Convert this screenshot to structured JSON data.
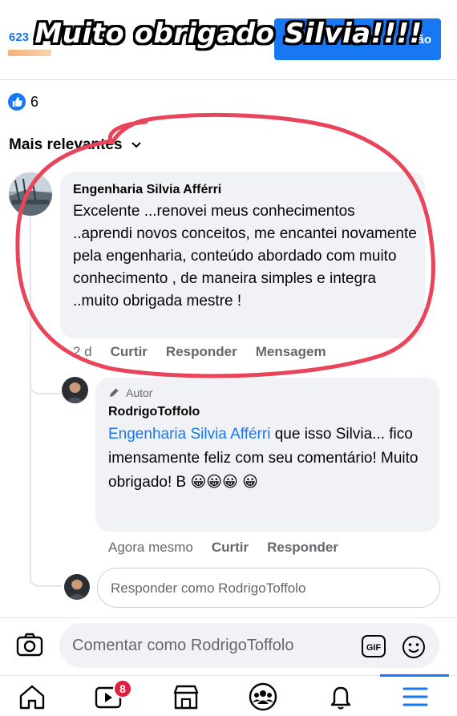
{
  "header": {
    "count_label": "623",
    "button_label": "ão",
    "overlay_title": "Muito obrigado Silvia!!!!"
  },
  "reactions": {
    "count": "6"
  },
  "sort": {
    "label": "Mais relevantes"
  },
  "comment": {
    "author": "Engenharia Silvia Afférri",
    "text": "Excelente ...renovei meus conhecimentos ..aprendi novos conceitos, me encantei novamente pela engenharia, conteúdo abordado com muito conhecimento , de maneira simples e integra ..muito obrigada mestre !",
    "time": "2 d",
    "like_label": "Curtir",
    "reply_label": "Responder",
    "message_label": "Mensagem"
  },
  "reply": {
    "badge": "Autor",
    "author": "RodrigoToffolo",
    "mention": "Engenharia Silvia Afférri",
    "text": " que isso Silvia... fico imensamente feliz com seu comentário! Muito obrigado! B ",
    "emojis": "😀😀😀 😀",
    "time": "Agora mesmo",
    "like_label": "Curtir",
    "reply_label": "Responder"
  },
  "reply_input": {
    "placeholder": "Responder como RodrigoToffolo"
  },
  "comment_input": {
    "placeholder": "Comentar como RodrigoToffolo"
  },
  "nav": {
    "video_badge": "8"
  },
  "colors": {
    "accent": "#1877f2",
    "annotation": "#e8445a",
    "badge": "#e41e3f"
  }
}
